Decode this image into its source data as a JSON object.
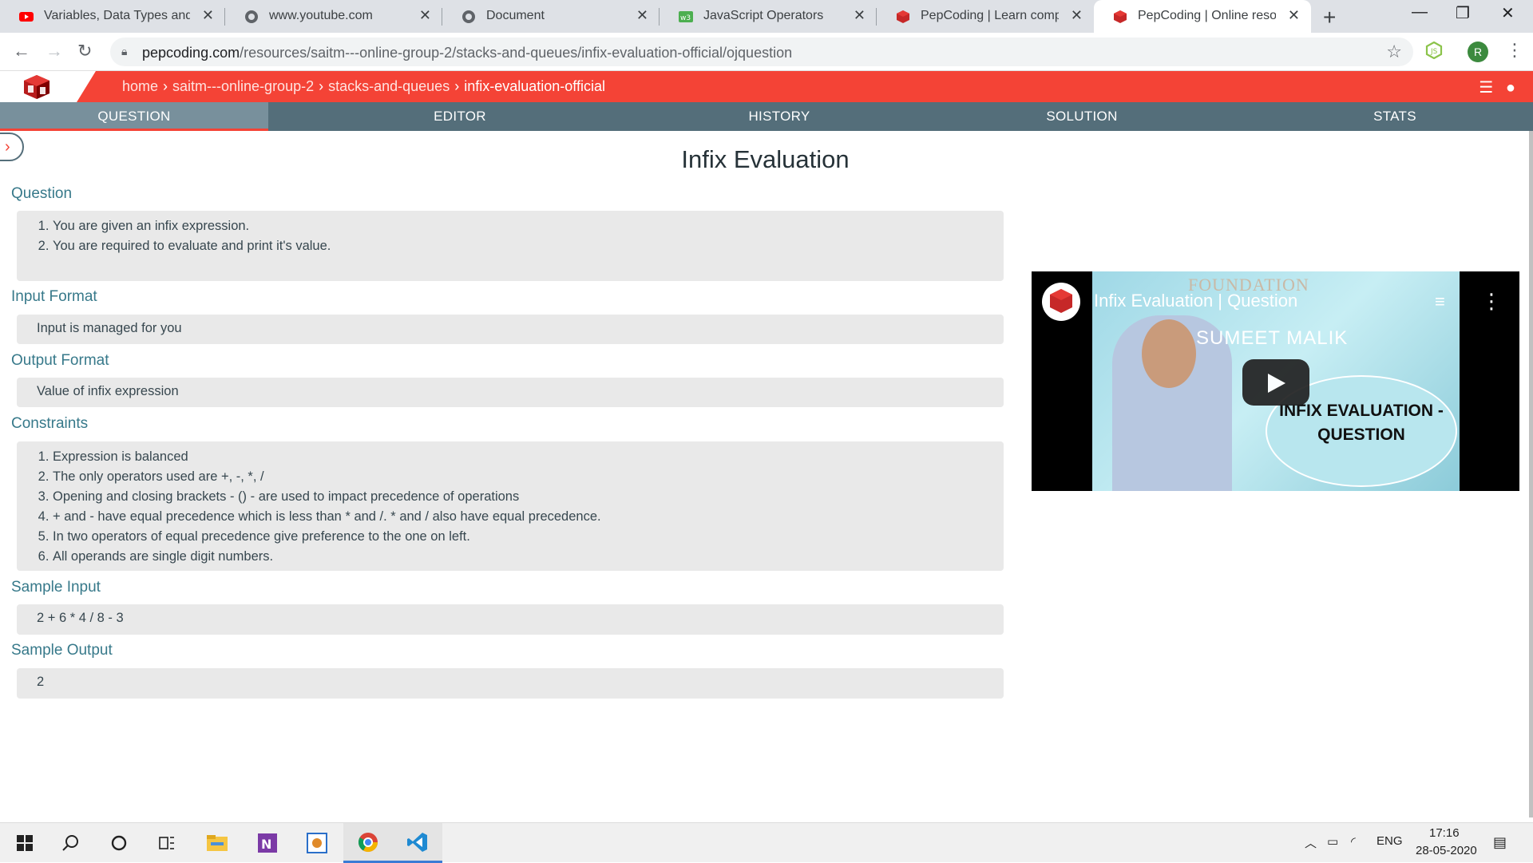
{
  "browser": {
    "tabs": [
      {
        "title": "Variables, Data Types and Op",
        "icon": "youtube-icon",
        "active": false
      },
      {
        "title": "www.youtube.com",
        "icon": "globe-icon",
        "active": false
      },
      {
        "title": "Document",
        "icon": "globe-icon",
        "active": false
      },
      {
        "title": "JavaScript Operators",
        "icon": "w3schools-icon",
        "active": false
      },
      {
        "title": "PepCoding | Learn competiti",
        "icon": "pepcoding-icon",
        "active": false
      },
      {
        "title": "PepCoding | Online resource",
        "icon": "pepcoding-icon",
        "active": true
      }
    ],
    "url_host": "pepcoding.com",
    "url_path": "/resources/saitm---online-group-2/stacks-and-queues/infix-evaluation-official/ojquestion",
    "profile_initial": "R"
  },
  "site": {
    "breadcrumb": [
      "home",
      "saitm---online-group-2",
      "stacks-and-queues",
      "infix-evaluation-official"
    ],
    "tabs": [
      "QUESTION",
      "EDITOR",
      "HISTORY",
      "SOLUTION",
      "STATS"
    ],
    "active_tab": "QUESTION",
    "brand_color": "#f44336"
  },
  "problem": {
    "title": "Infix Evaluation",
    "question_label": "Question",
    "question": [
      "You are given an infix expression.",
      "You are required to evaluate and print it's value."
    ],
    "input_format_label": "Input Format",
    "input_format": "Input is managed for you",
    "output_format_label": "Output Format",
    "output_format": "Value of infix expression",
    "constraints_label": "Constraints",
    "constraints": [
      "Expression is balanced",
      "The only operators used are +, -, *, /",
      "Opening and closing brackets - () - are used to impact precedence of operations",
      "+ and - have equal precedence which is less than * and /. * and / also have equal precedence.",
      "In two operators of equal precedence give preference to the one on left.",
      "All operands are single digit numbers."
    ],
    "sample_input_label": "Sample Input",
    "sample_input": "2 + 6 * 4 / 8 - 3",
    "sample_output_label": "Sample Output",
    "sample_output": "2"
  },
  "video": {
    "title": "Infix Evaluation | Question",
    "presenter": "SUMEET MALIK",
    "banner": "FOUNDATION",
    "oval_text": "INFIX EVALUATION - QUESTION"
  },
  "taskbar": {
    "time": "17:16",
    "date": "28-05-2020",
    "lang": "ENG"
  }
}
